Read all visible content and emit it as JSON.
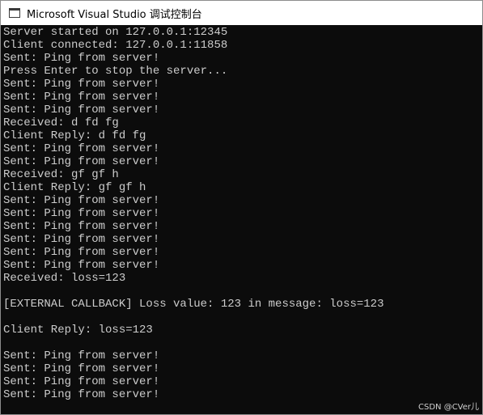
{
  "window": {
    "title": "Microsoft Visual Studio 调试控制台",
    "icon": "console-app-icon"
  },
  "console": {
    "lines": [
      "Server started on 127.0.0.1:12345",
      "Client connected: 127.0.0.1:11858",
      "Sent: Ping from server!",
      "Press Enter to stop the server...",
      "Sent: Ping from server!",
      "Sent: Ping from server!",
      "Sent: Ping from server!",
      "Received: d fd fg",
      "Client Reply: d fd fg",
      "Sent: Ping from server!",
      "Sent: Ping from server!",
      "Received: gf gf h",
      "Client Reply: gf gf h",
      "Sent: Ping from server!",
      "Sent: Ping from server!",
      "Sent: Ping from server!",
      "Sent: Ping from server!",
      "Sent: Ping from server!",
      "Sent: Ping from server!",
      "Received: loss=123",
      "",
      "[EXTERNAL CALLBACK] Loss value: 123 in message: loss=123",
      "",
      "Client Reply: loss=123",
      "",
      "Sent: Ping from server!",
      "Sent: Ping from server!",
      "Sent: Ping from server!",
      "Sent: Ping from server!"
    ]
  },
  "watermark": "CSDN @CVer儿",
  "colors": {
    "console_background": "#0c0c0c",
    "console_text": "#cccccc",
    "titlebar_background": "#ffffff"
  }
}
